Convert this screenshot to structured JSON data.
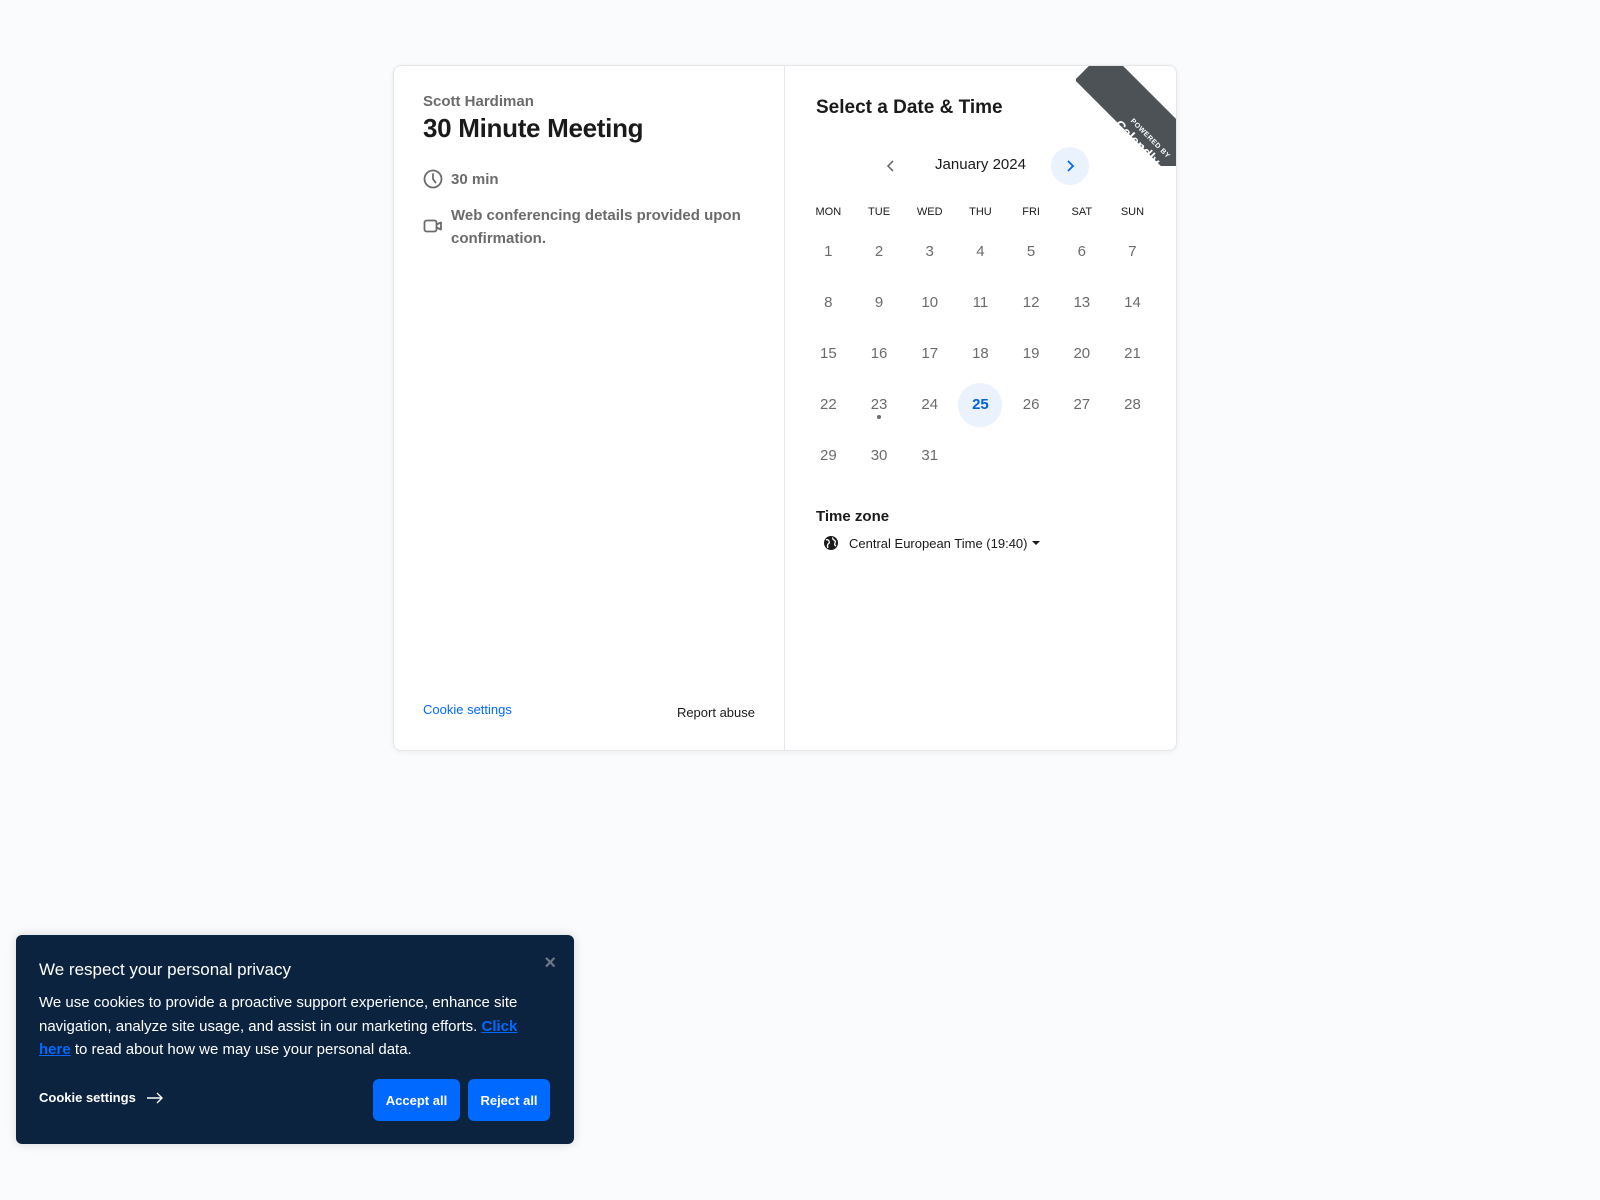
{
  "event": {
    "host": "Scott Hardiman",
    "title": "30 Minute Meeting",
    "duration": "30 min",
    "location": "Web conferencing details provided upon confirmation.",
    "icons": {
      "duration": "clock-icon",
      "location": "video-camera-icon"
    }
  },
  "left_footer": {
    "cookie_settings": "Cookie settings",
    "report_abuse": "Report abuse"
  },
  "calendar": {
    "heading": "Select a Date & Time",
    "month_label": "January 2024",
    "prev_label": "‹",
    "next_label": "›",
    "weekdays": [
      "MON",
      "TUE",
      "WED",
      "THU",
      "FRI",
      "SAT",
      "SUN"
    ],
    "days": [
      "1",
      "2",
      "3",
      "4",
      "5",
      "6",
      "7",
      "8",
      "9",
      "10",
      "11",
      "12",
      "13",
      "14",
      "15",
      "16",
      "17",
      "18",
      "19",
      "20",
      "21",
      "22",
      "23",
      "24",
      "25",
      "26",
      "27",
      "28",
      "29",
      "30",
      "31"
    ],
    "selected_day": "25",
    "today_marker_day": "23",
    "accent_color": "#0069ff"
  },
  "timezone": {
    "label": "Time zone",
    "value": "Central European Time (19:40)",
    "icon": "globe-icon"
  },
  "ribbon": {
    "powered_by": "POWERED BY",
    "brand": "Calendly"
  },
  "cookie_banner": {
    "title": "We respect your personal privacy",
    "body_before_link": "We use cookies to provide a proactive support experience, enhance site navigation, analyze site usage, and assist in our marketing efforts. ",
    "link_text": "Click here",
    "body_after_link": " to read about how we may use your personal data.",
    "settings_label": "Cookie settings",
    "accept_label": "Accept all",
    "reject_label": "Reject all",
    "close_label": "×",
    "background_color": "#0c2340",
    "button_color": "#0069ff"
  }
}
